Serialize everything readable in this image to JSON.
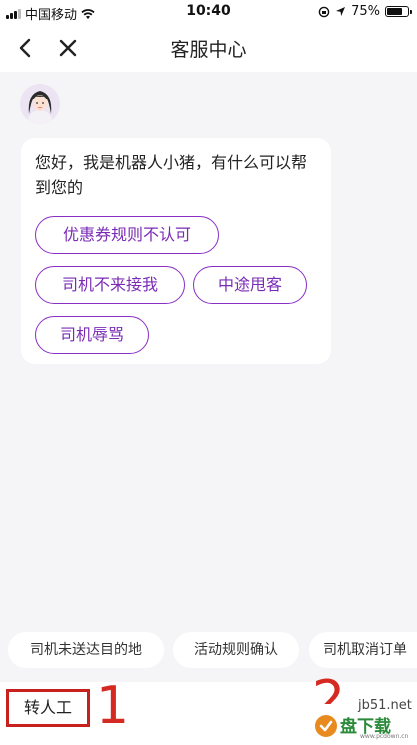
{
  "status_bar": {
    "carrier": "中国移动",
    "time": "10:40",
    "battery_percent": "75%",
    "battery_level": 0.75,
    "icons": [
      "signal-icon",
      "wifi-icon",
      "screen-lock-icon",
      "location-icon",
      "battery-icon"
    ]
  },
  "nav": {
    "title": "客服中心",
    "icons": [
      "back-icon",
      "close-icon"
    ]
  },
  "chat": {
    "greeting": "您好，我是机器人小猪，有什么可以帮到您的",
    "options": [
      "优惠券规则不认可",
      "司机不来接我",
      "中途甩客",
      "司机辱骂"
    ]
  },
  "quick_replies": [
    "司机未送达目的地",
    "活动规则确认",
    "司机取消订单"
  ],
  "input_bar": {
    "transfer_label": "转人工",
    "annotation_1": "1",
    "annotation_2": "2"
  },
  "watermark": {
    "url": "jb51.net",
    "logo_text": "盘下载",
    "logo_sub": "www.pcdown.cn"
  },
  "colors": {
    "accent": "#8a2fc4",
    "annotation_red": "#d42a22",
    "background": "#f5f5f7"
  }
}
